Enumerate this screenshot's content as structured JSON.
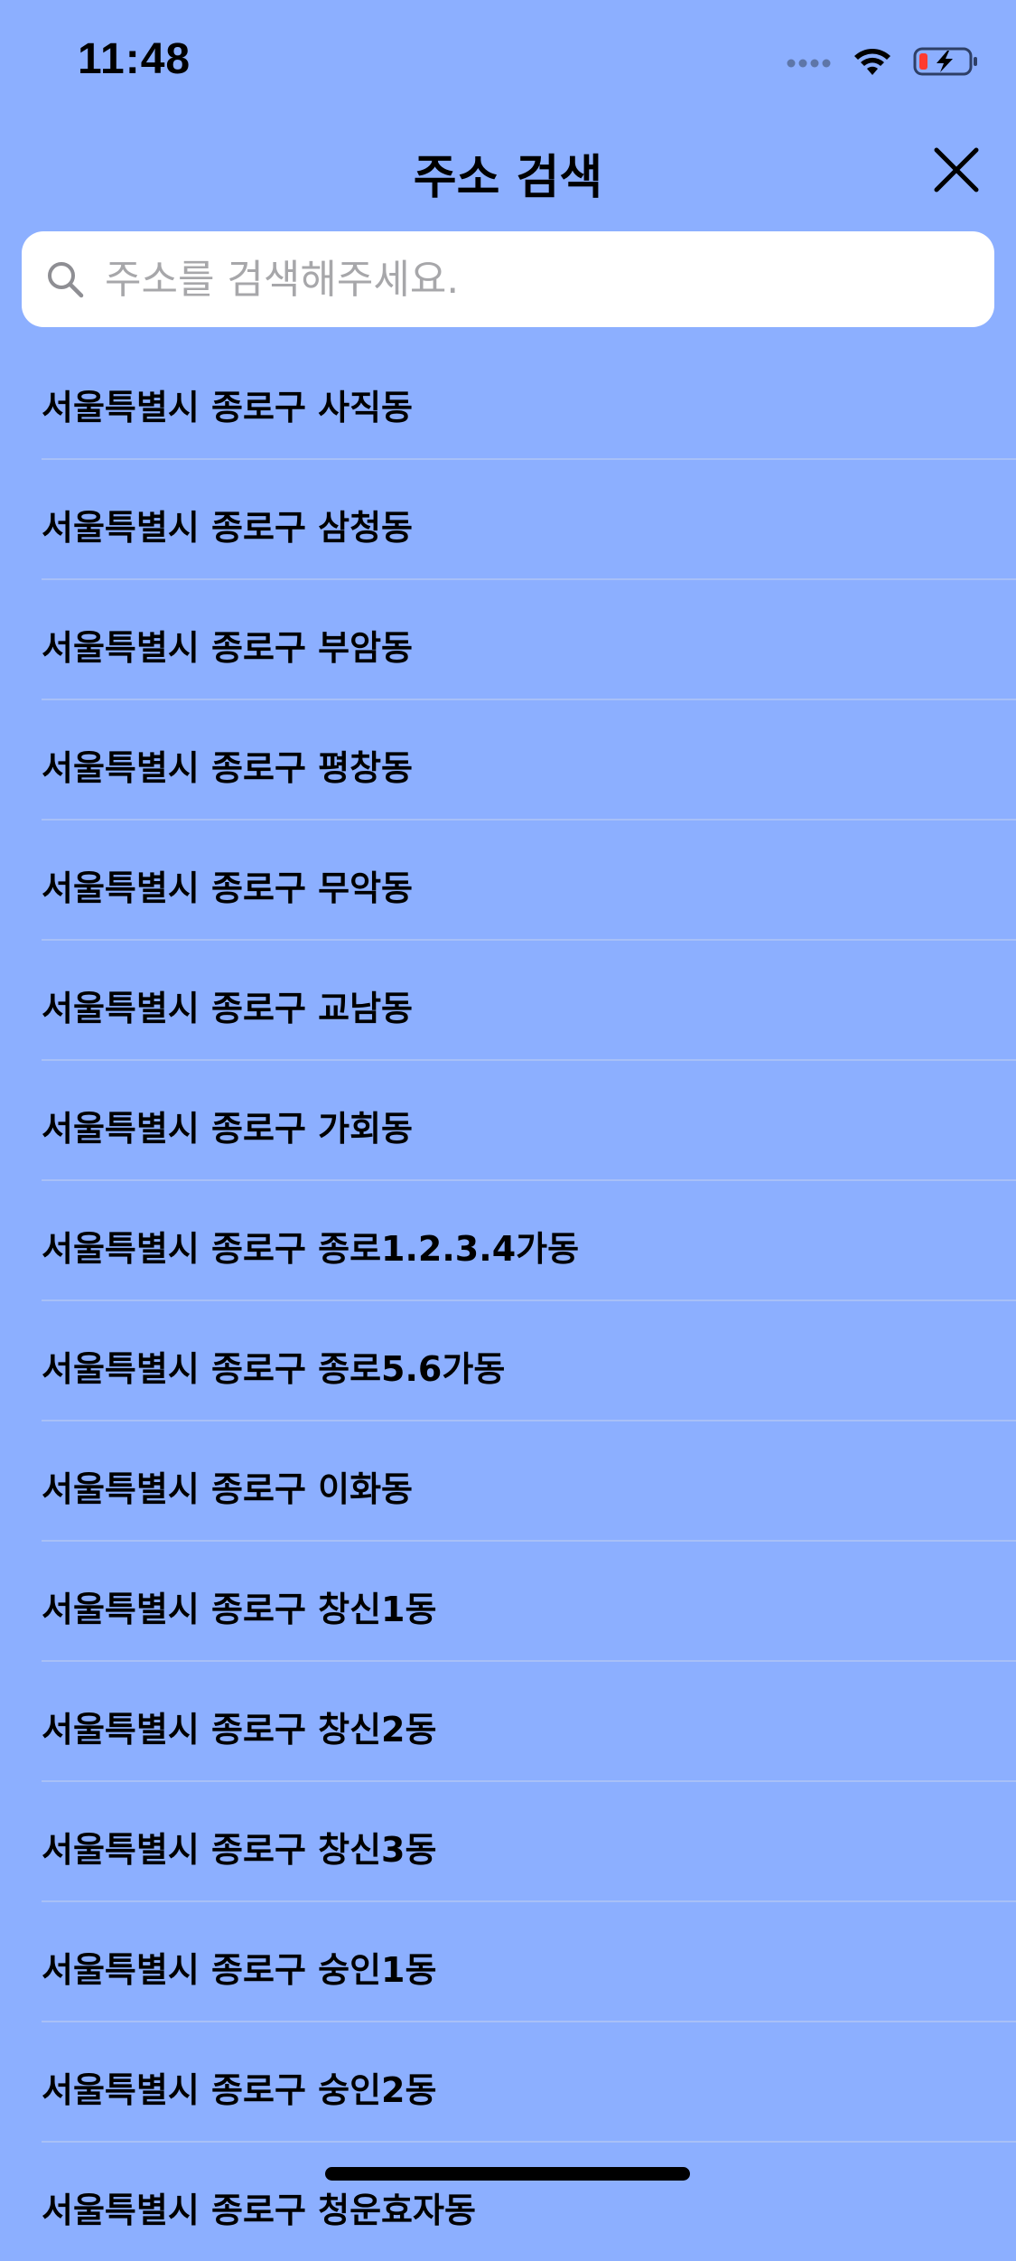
{
  "status_bar": {
    "time": "11:48",
    "icons": [
      "cellular-signal-icon",
      "wifi-icon",
      "battery-low-charging-icon"
    ],
    "battery_color": "#FF3B30"
  },
  "header": {
    "title": "주소 검색",
    "close_icon": "close-icon"
  },
  "search": {
    "placeholder": "주소를 검색해주세요.",
    "value": "",
    "icon": "search-icon"
  },
  "addresses": [
    "서울특별시 종로구 사직동",
    "서울특별시 종로구 삼청동",
    "서울특별시 종로구 부암동",
    "서울특별시 종로구 평창동",
    "서울특별시 종로구 무악동",
    "서울특별시 종로구 교남동",
    "서울특별시 종로구 가회동",
    "서울특별시 종로구 종로1.2.3.4가동",
    "서울특별시 종로구 종로5.6가동",
    "서울특별시 종로구 이화동",
    "서울특별시 종로구 창신1동",
    "서울특별시 종로구 창신2동",
    "서울특별시 종로구 창신3동",
    "서울특별시 종로구 숭인1동",
    "서울특별시 종로구 숭인2동",
    "서울특별시 종로구 청운효자동"
  ],
  "colors": {
    "background": "#8CAFFF",
    "separator": "#A8C0F7",
    "search_background": "#FFFFFF",
    "placeholder": "#A7A7AA"
  }
}
